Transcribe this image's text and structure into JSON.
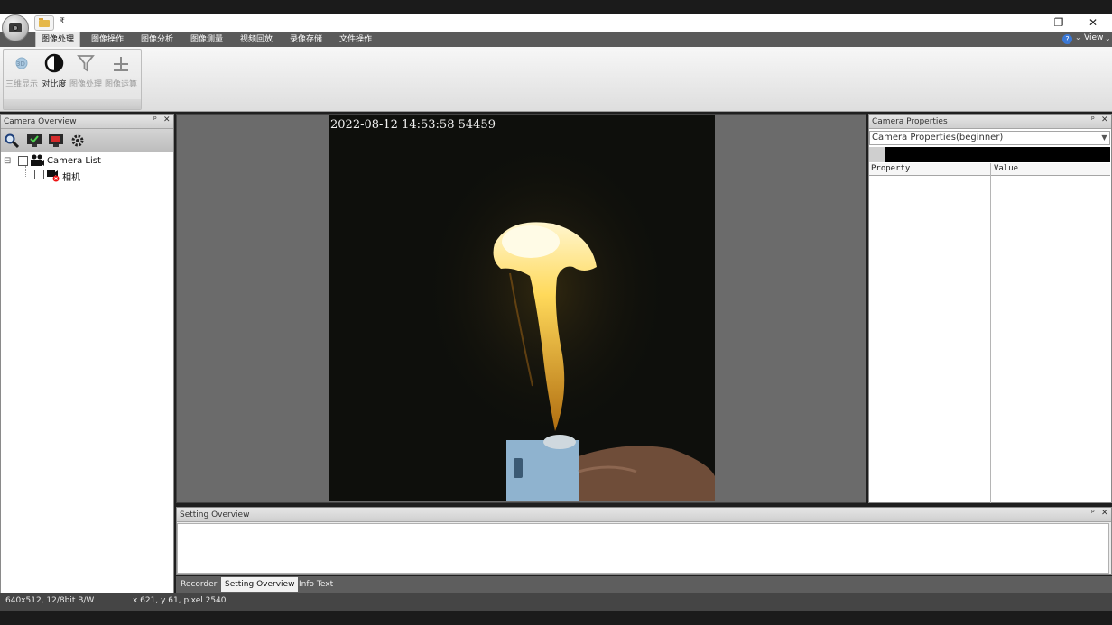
{
  "ribbon": {
    "tabs": [
      "图像处理",
      "图像操作",
      "图像分析",
      "图像测量",
      "视频回放",
      "录像存储",
      "文件操作"
    ],
    "active_tab": "图像处理",
    "buttons": [
      {
        "label": "三维显示",
        "icon": "3d-display-icon",
        "enabled": false
      },
      {
        "label": "对比度",
        "icon": "contrast-icon",
        "enabled": true
      },
      {
        "label": "图像处理",
        "icon": "filter-icon",
        "enabled": false
      },
      {
        "label": "图像运算",
        "icon": "image-operation-icon",
        "enabled": false
      }
    ],
    "view_label": "View"
  },
  "left_panel": {
    "title": "Camera Overview",
    "pin_glyph": "ᵖ",
    "close_glyph": "✕",
    "toolbar_icons": [
      "search-icon",
      "connect-camera-icon",
      "disconnect-camera-icon",
      "settings-gear-icon"
    ],
    "tree": {
      "root_label": "Camera List",
      "expander": "⊟",
      "child_label": "相机"
    }
  },
  "center": {
    "timestamp": "2022-08-12  14:53:58  54459"
  },
  "right_panel": {
    "title": "Camera Properties",
    "select_value": "Camera Properties(beginner)",
    "columns": [
      "Property",
      "Value"
    ]
  },
  "bottom_panel": {
    "title": "Setting Overview",
    "tabs": [
      "Recorder",
      "Setting Overview",
      "Info Text"
    ],
    "active_tab": "Setting Overview"
  },
  "status": {
    "format": "640x512, 12/8bit B/W",
    "cursor": "x 621, y 61, pixel 2540"
  },
  "window": {
    "minimize": "–",
    "restore": "❐",
    "close": "✕",
    "qa_more": "₹"
  },
  "colors": {
    "ribbon_tab_bg": "#5a5a5a",
    "panel_header": "#d6d6d6",
    "image_bg": "#0e0f0c",
    "flame": "#ffe38a",
    "help_blue": "#3a78d6"
  }
}
